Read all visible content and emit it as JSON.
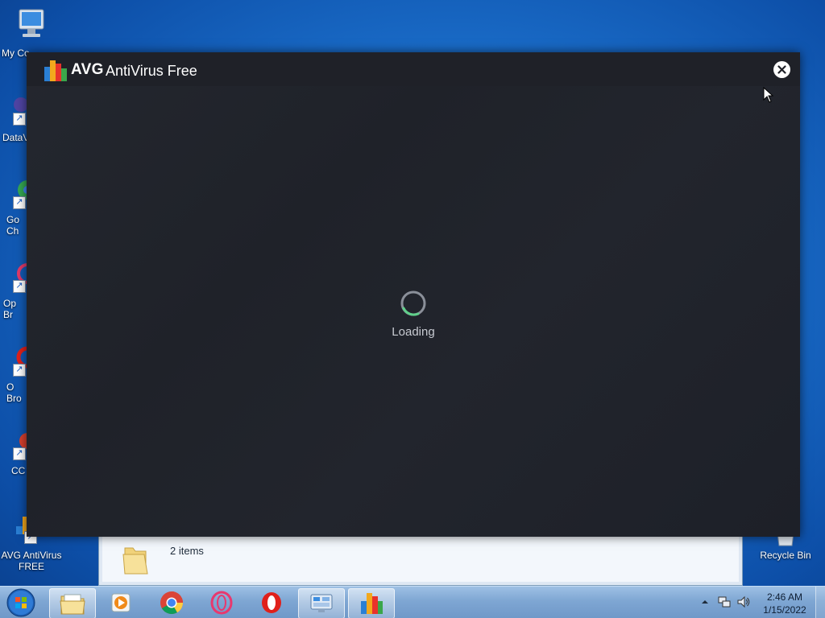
{
  "desktop": {
    "icons": [
      {
        "label": "My Co",
        "icon": "computer-icon"
      },
      {
        "label": "DataV",
        "icon": "shortcut-icon"
      },
      {
        "label": "Go\nCh",
        "icon": "chrome-icon"
      },
      {
        "label": "Op\nBr",
        "icon": "opera-icon"
      },
      {
        "label": "O\nBro",
        "icon": "opera-icon"
      },
      {
        "label": "CC",
        "icon": "ccleaner-icon"
      },
      {
        "label": "AVG AntiVirus\nFREE",
        "icon": "avg-icon"
      },
      {
        "label": "Recycle Bin",
        "icon": "recycle-bin-icon"
      }
    ]
  },
  "avg_window": {
    "brand": "AVG",
    "product": "AntiVirus Free",
    "loading_text": "Loading",
    "close_icon": "close-icon",
    "background_color": "#22252d",
    "spinner_color": "#5fd08a"
  },
  "explorer": {
    "item_count": "2 items"
  },
  "taskbar": {
    "buttons": [
      {
        "name": "start-button",
        "icon": "windows-orb-icon"
      },
      {
        "name": "explorer",
        "icon": "folder-icon"
      },
      {
        "name": "media-player",
        "icon": "media-player-icon"
      },
      {
        "name": "chrome",
        "icon": "chrome-icon"
      },
      {
        "name": "opera-gx",
        "icon": "opera-gx-icon"
      },
      {
        "name": "opera",
        "icon": "opera-icon"
      },
      {
        "name": "control-panel",
        "icon": "control-panel-icon"
      },
      {
        "name": "avg",
        "icon": "avg-icon"
      }
    ],
    "clock": {
      "time": "2:46 AM",
      "date": "1/15/2022"
    }
  }
}
